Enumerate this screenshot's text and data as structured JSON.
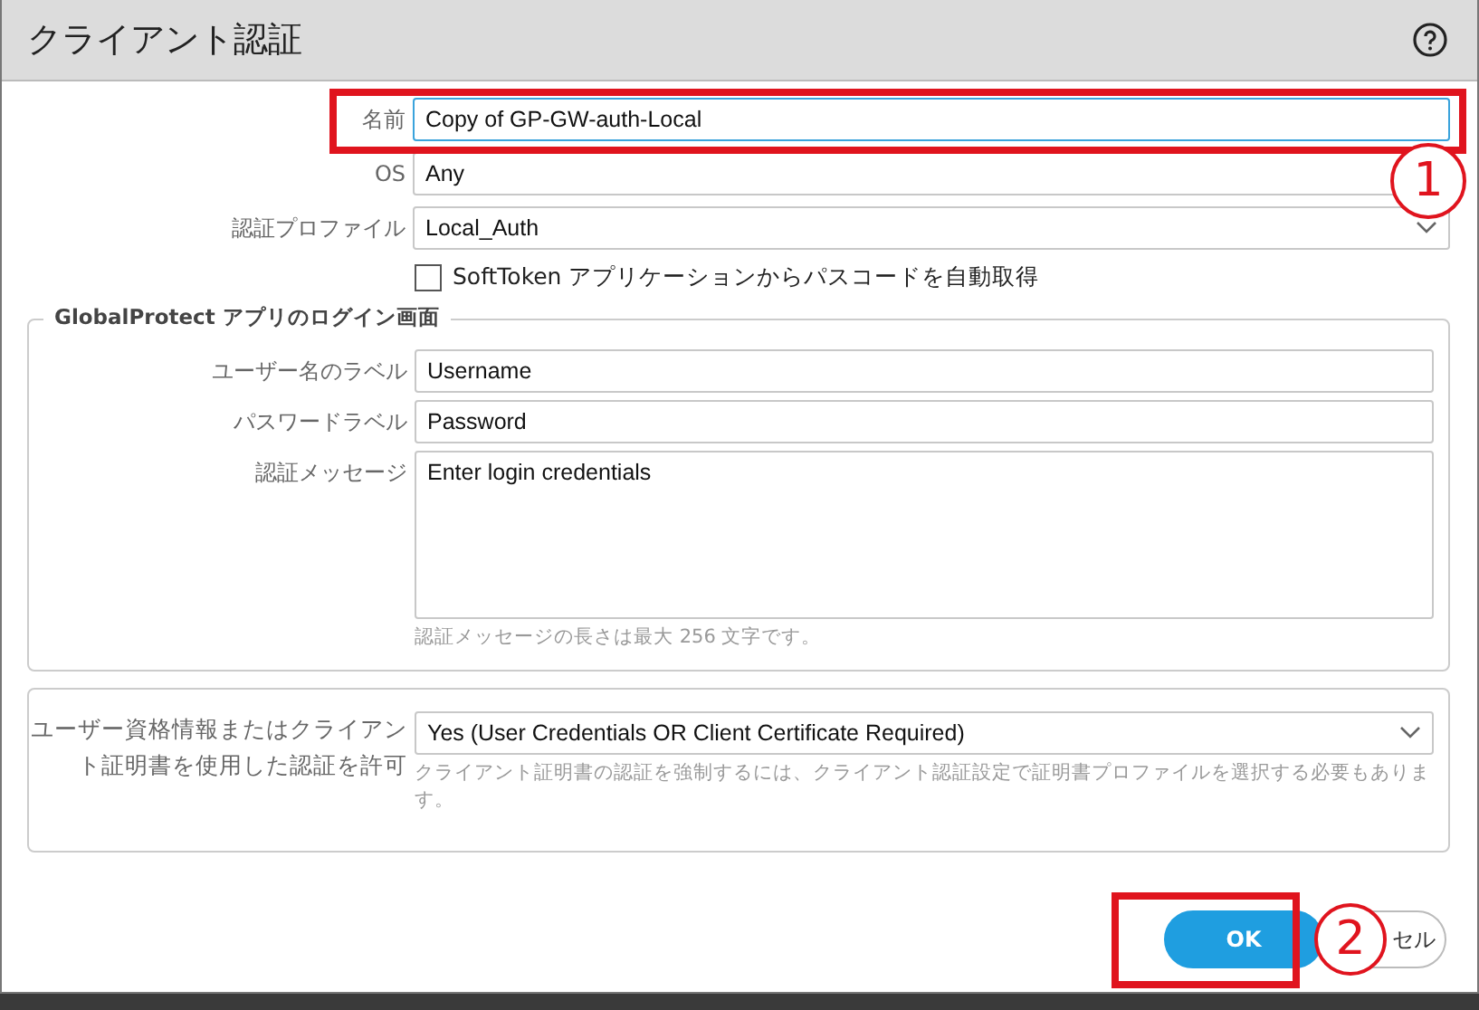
{
  "window": {
    "title": "クライアント認証"
  },
  "fields": [
    {
      "label": "名前",
      "value": "Copy of GP-GW-auth-Local",
      "kind": "text",
      "focused": true
    },
    {
      "label": "OS",
      "value": "Any",
      "kind": "text",
      "focused": false
    },
    {
      "label": "認証プロファイル",
      "value": "Local_Auth",
      "kind": "select",
      "focused": false
    }
  ],
  "checkbox": {
    "label": "SoftToken アプリケーションからパスコードを自動取得",
    "checked": false
  },
  "login_section": {
    "title": "GlobalProtect アプリのログイン画面",
    "fields": [
      {
        "label": "ユーザー名のラベル",
        "value": "Username"
      },
      {
        "label": "パスワードラベル",
        "value": "Password"
      }
    ],
    "message": {
      "label": "認証メッセージ",
      "value": "Enter login credentials",
      "hint": "認証メッセージの長さは最大 256 文字です。"
    }
  },
  "allow_auth": {
    "label": "ユーザー資格情報またはクライアント証明書を使用した認証を許可",
    "value": "Yes (User Credentials OR Client Certificate Required)",
    "hint": "クライアント証明書の認証を強制するには、クライアント認証設定で証明書プロファイルを選択する必要もあります。"
  },
  "buttons": [
    {
      "label": "OK",
      "kind": "primary"
    },
    {
      "label": "セル",
      "kind": "secondary"
    }
  ],
  "annotations": [
    {
      "number": "1"
    },
    {
      "number": "2"
    }
  ]
}
